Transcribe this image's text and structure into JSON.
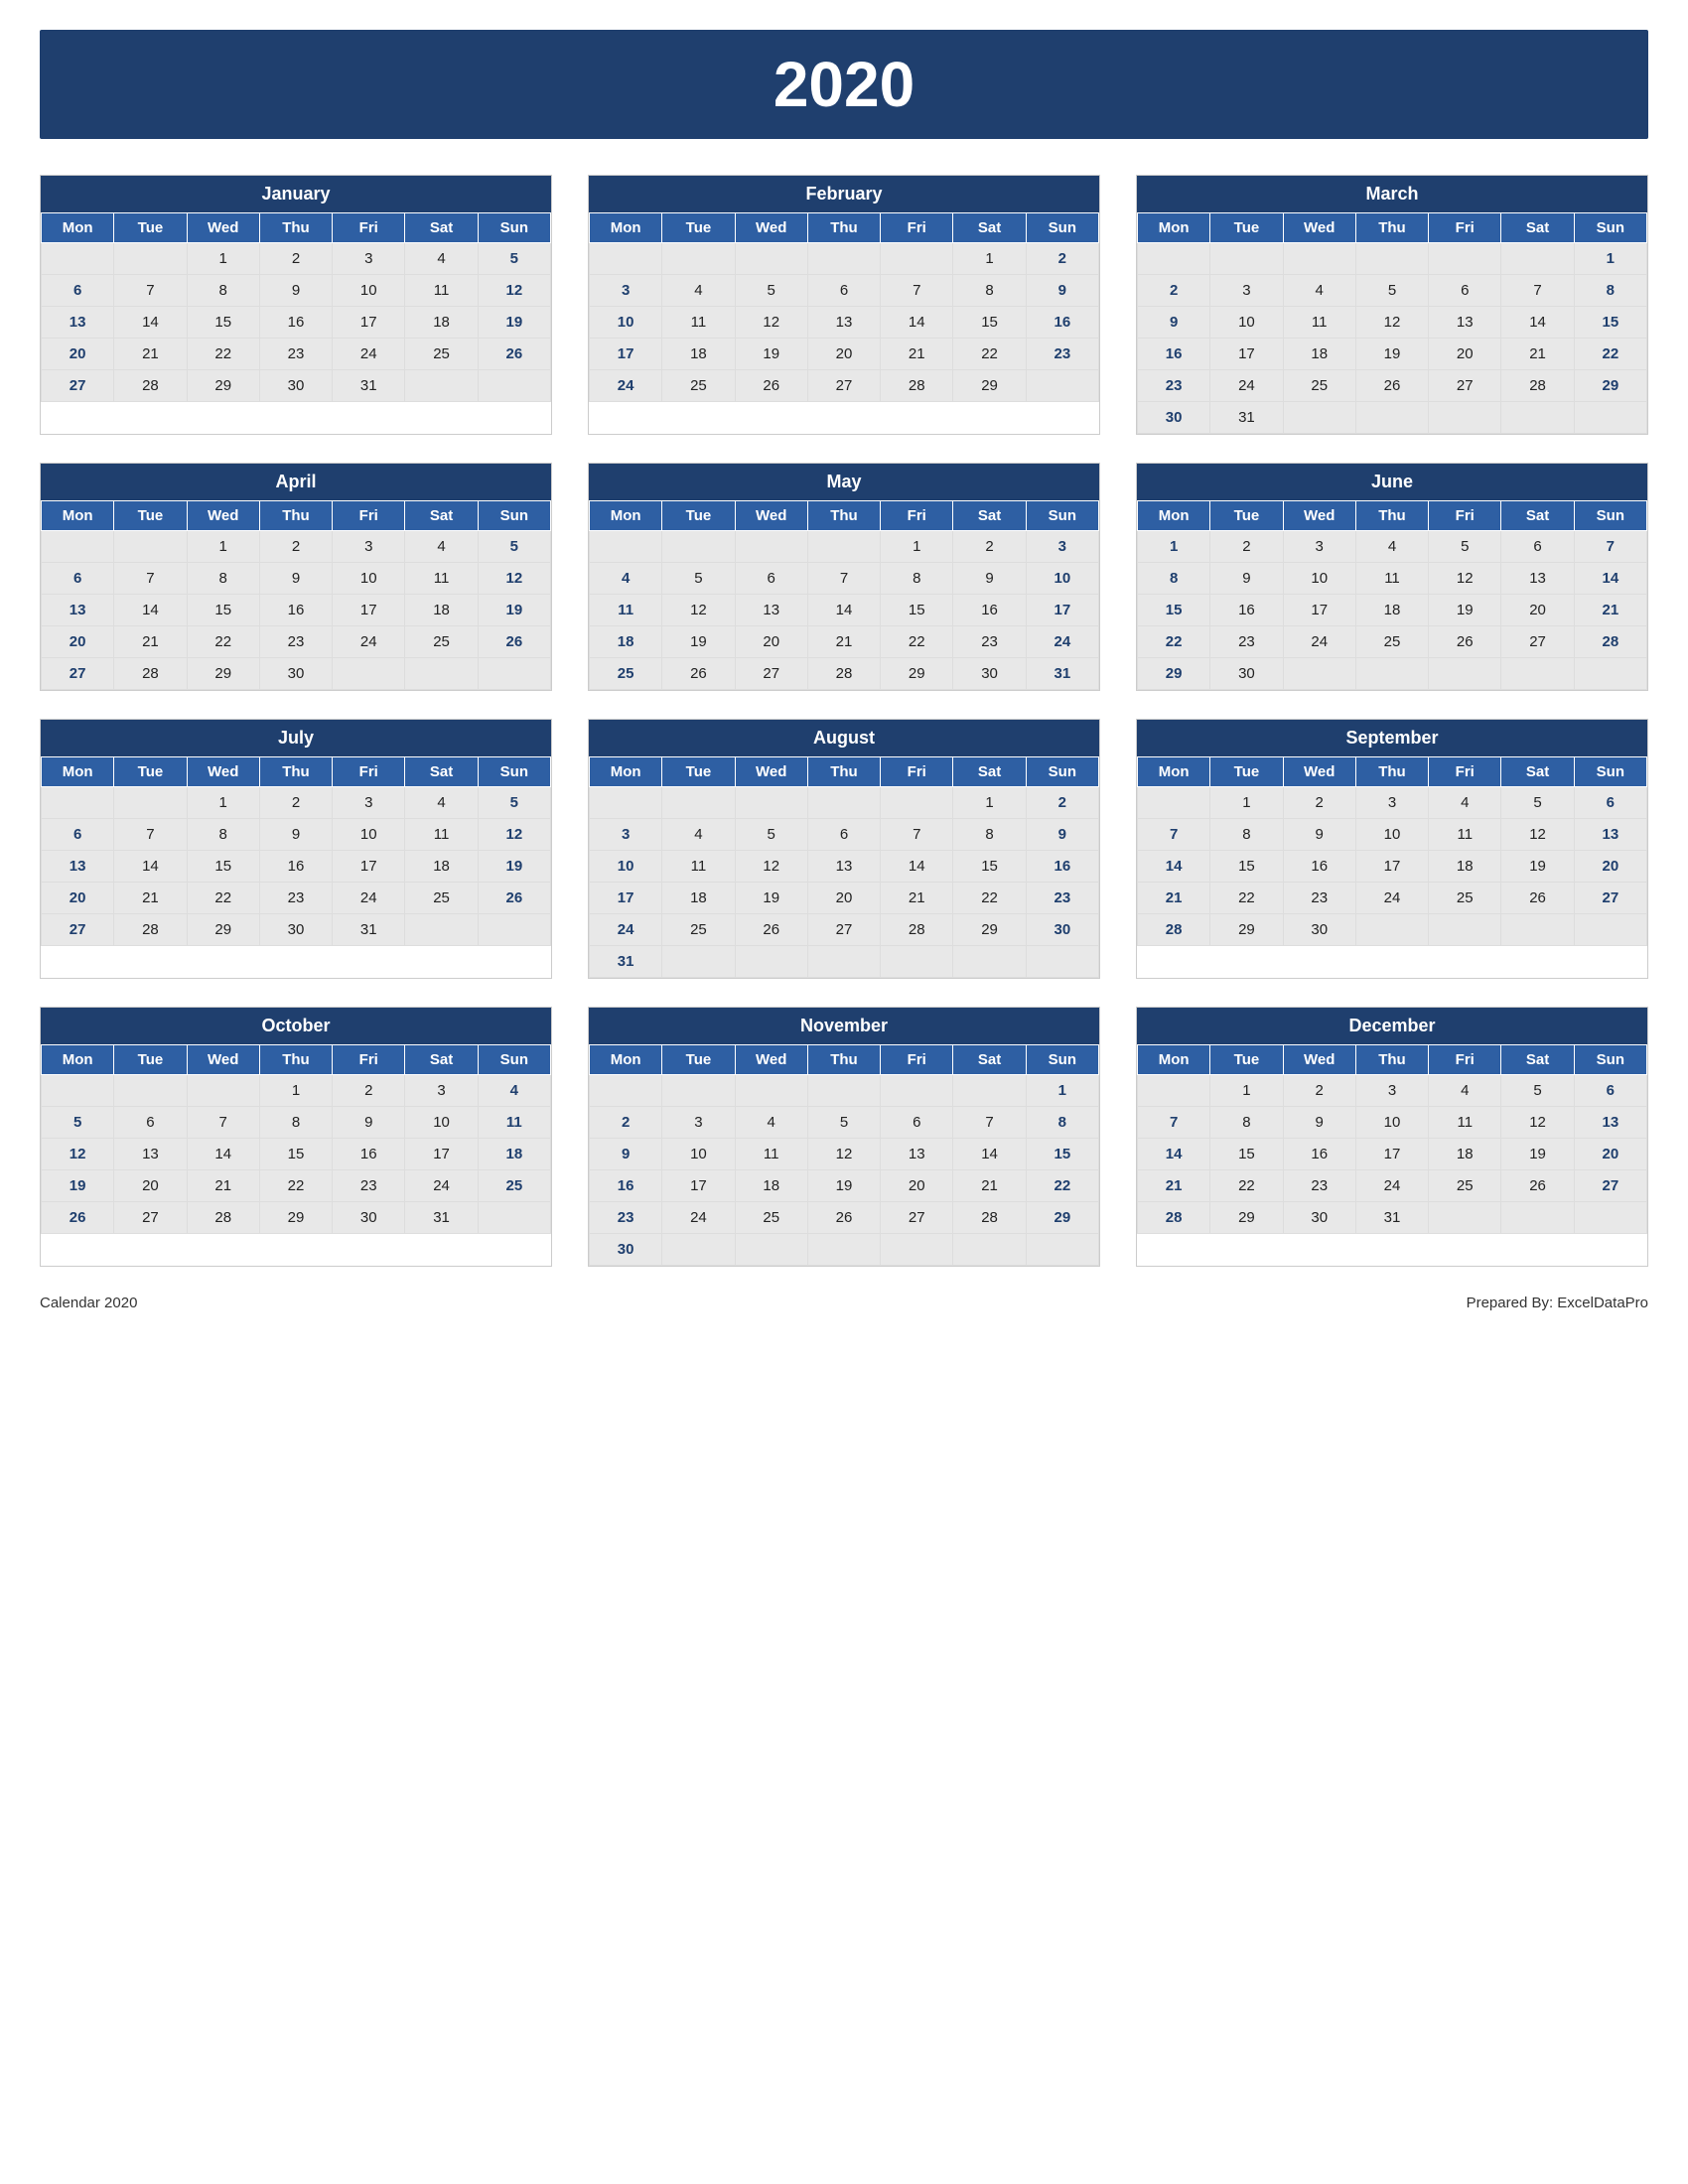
{
  "header": {
    "year": "2020"
  },
  "footer": {
    "left": "Calendar 2020",
    "right": "Prepared By: ExcelDataPro"
  },
  "months": [
    {
      "name": "January",
      "days_header": [
        "Mon",
        "Tue",
        "Wed",
        "Thu",
        "Fri",
        "Sat",
        "Sun"
      ],
      "weeks": [
        [
          "",
          "",
          "1",
          "2",
          "3",
          "4",
          "5"
        ],
        [
          "6",
          "7",
          "8",
          "9",
          "10",
          "11",
          "12"
        ],
        [
          "13",
          "14",
          "15",
          "16",
          "17",
          "18",
          "19"
        ],
        [
          "20",
          "21",
          "22",
          "23",
          "24",
          "25",
          "26"
        ],
        [
          "27",
          "28",
          "29",
          "30",
          "31",
          "",
          ""
        ]
      ]
    },
    {
      "name": "February",
      "days_header": [
        "Mon",
        "Tue",
        "Wed",
        "Thu",
        "Fri",
        "Sat",
        "Sun"
      ],
      "weeks": [
        [
          "",
          "",
          "",
          "",
          "",
          "1",
          "2"
        ],
        [
          "3",
          "4",
          "5",
          "6",
          "7",
          "8",
          "9"
        ],
        [
          "10",
          "11",
          "12",
          "13",
          "14",
          "15",
          "16"
        ],
        [
          "17",
          "18",
          "19",
          "20",
          "21",
          "22",
          "23"
        ],
        [
          "24",
          "25",
          "26",
          "27",
          "28",
          "29",
          ""
        ]
      ]
    },
    {
      "name": "March",
      "days_header": [
        "Mon",
        "Tue",
        "Wed",
        "Thu",
        "Fri",
        "Sat",
        "Sun"
      ],
      "weeks": [
        [
          "",
          "",
          "",
          "",
          "",
          "",
          "1"
        ],
        [
          "2",
          "3",
          "4",
          "5",
          "6",
          "7",
          "8"
        ],
        [
          "9",
          "10",
          "11",
          "12",
          "13",
          "14",
          "15"
        ],
        [
          "16",
          "17",
          "18",
          "19",
          "20",
          "21",
          "22"
        ],
        [
          "23",
          "24",
          "25",
          "26",
          "27",
          "28",
          "29"
        ],
        [
          "30",
          "31",
          "",
          "",
          "",
          "",
          ""
        ]
      ]
    },
    {
      "name": "April",
      "days_header": [
        "Mon",
        "Tue",
        "Wed",
        "Thu",
        "Fri",
        "Sat",
        "Sun"
      ],
      "weeks": [
        [
          "",
          "",
          "1",
          "2",
          "3",
          "4",
          "5"
        ],
        [
          "6",
          "7",
          "8",
          "9",
          "10",
          "11",
          "12"
        ],
        [
          "13",
          "14",
          "15",
          "16",
          "17",
          "18",
          "19"
        ],
        [
          "20",
          "21",
          "22",
          "23",
          "24",
          "25",
          "26"
        ],
        [
          "27",
          "28",
          "29",
          "30",
          "",
          "",
          ""
        ]
      ]
    },
    {
      "name": "May",
      "days_header": [
        "Mon",
        "Tue",
        "Wed",
        "Thu",
        "Fri",
        "Sat",
        "Sun"
      ],
      "weeks": [
        [
          "",
          "",
          "",
          "",
          "1",
          "2",
          "3"
        ],
        [
          "4",
          "5",
          "6",
          "7",
          "8",
          "9",
          "10"
        ],
        [
          "11",
          "12",
          "13",
          "14",
          "15",
          "16",
          "17"
        ],
        [
          "18",
          "19",
          "20",
          "21",
          "22",
          "23",
          "24"
        ],
        [
          "25",
          "26",
          "27",
          "28",
          "29",
          "30",
          "31"
        ]
      ]
    },
    {
      "name": "June",
      "days_header": [
        "Mon",
        "Tue",
        "Wed",
        "Thu",
        "Fri",
        "Sat",
        "Sun"
      ],
      "weeks": [
        [
          "1",
          "2",
          "3",
          "4",
          "5",
          "6",
          "7"
        ],
        [
          "8",
          "9",
          "10",
          "11",
          "12",
          "13",
          "14"
        ],
        [
          "15",
          "16",
          "17",
          "18",
          "19",
          "20",
          "21"
        ],
        [
          "22",
          "23",
          "24",
          "25",
          "26",
          "27",
          "28"
        ],
        [
          "29",
          "30",
          "",
          "",
          "",
          "",
          ""
        ]
      ]
    },
    {
      "name": "July",
      "days_header": [
        "Mon",
        "Tue",
        "Wed",
        "Thu",
        "Fri",
        "Sat",
        "Sun"
      ],
      "weeks": [
        [
          "",
          "",
          "1",
          "2",
          "3",
          "4",
          "5"
        ],
        [
          "6",
          "7",
          "8",
          "9",
          "10",
          "11",
          "12"
        ],
        [
          "13",
          "14",
          "15",
          "16",
          "17",
          "18",
          "19"
        ],
        [
          "20",
          "21",
          "22",
          "23",
          "24",
          "25",
          "26"
        ],
        [
          "27",
          "28",
          "29",
          "30",
          "31",
          "",
          ""
        ]
      ]
    },
    {
      "name": "August",
      "days_header": [
        "Mon",
        "Tue",
        "Wed",
        "Thu",
        "Fri",
        "Sat",
        "Sun"
      ],
      "weeks": [
        [
          "",
          "",
          "",
          "",
          "",
          "1",
          "2"
        ],
        [
          "3",
          "4",
          "5",
          "6",
          "7",
          "8",
          "9"
        ],
        [
          "10",
          "11",
          "12",
          "13",
          "14",
          "15",
          "16"
        ],
        [
          "17",
          "18",
          "19",
          "20",
          "21",
          "22",
          "23"
        ],
        [
          "24",
          "25",
          "26",
          "27",
          "28",
          "29",
          "30"
        ],
        [
          "31",
          "",
          "",
          "",
          "",
          "",
          ""
        ]
      ]
    },
    {
      "name": "September",
      "days_header": [
        "Mon",
        "Tue",
        "Wed",
        "Thu",
        "Fri",
        "Sat",
        "Sun"
      ],
      "weeks": [
        [
          "",
          "1",
          "2",
          "3",
          "4",
          "5",
          "6"
        ],
        [
          "7",
          "8",
          "9",
          "10",
          "11",
          "12",
          "13"
        ],
        [
          "14",
          "15",
          "16",
          "17",
          "18",
          "19",
          "20"
        ],
        [
          "21",
          "22",
          "23",
          "24",
          "25",
          "26",
          "27"
        ],
        [
          "28",
          "29",
          "30",
          "",
          "",
          "",
          ""
        ]
      ]
    },
    {
      "name": "October",
      "days_header": [
        "Mon",
        "Tue",
        "Wed",
        "Thu",
        "Fri",
        "Sat",
        "Sun"
      ],
      "weeks": [
        [
          "",
          "",
          "",
          "1",
          "2",
          "3",
          "4"
        ],
        [
          "5",
          "6",
          "7",
          "8",
          "9",
          "10",
          "11"
        ],
        [
          "12",
          "13",
          "14",
          "15",
          "16",
          "17",
          "18"
        ],
        [
          "19",
          "20",
          "21",
          "22",
          "23",
          "24",
          "25"
        ],
        [
          "26",
          "27",
          "28",
          "29",
          "30",
          "31",
          ""
        ]
      ]
    },
    {
      "name": "November",
      "days_header": [
        "Mon",
        "Tue",
        "Wed",
        "Thu",
        "Fri",
        "Sat",
        "Sun"
      ],
      "weeks": [
        [
          "",
          "",
          "",
          "",
          "",
          "",
          "1"
        ],
        [
          "2",
          "3",
          "4",
          "5",
          "6",
          "7",
          "8"
        ],
        [
          "9",
          "10",
          "11",
          "12",
          "13",
          "14",
          "15"
        ],
        [
          "16",
          "17",
          "18",
          "19",
          "20",
          "21",
          "22"
        ],
        [
          "23",
          "24",
          "25",
          "26",
          "27",
          "28",
          "29"
        ],
        [
          "30",
          "",
          "",
          "",
          "",
          "",
          ""
        ]
      ]
    },
    {
      "name": "December",
      "days_header": [
        "Mon",
        "Tue",
        "Wed",
        "Thu",
        "Fri",
        "Sat",
        "Sun"
      ],
      "weeks": [
        [
          "",
          "1",
          "2",
          "3",
          "4",
          "5",
          "6"
        ],
        [
          "7",
          "8",
          "9",
          "10",
          "11",
          "12",
          "13"
        ],
        [
          "14",
          "15",
          "16",
          "17",
          "18",
          "19",
          "20"
        ],
        [
          "21",
          "22",
          "23",
          "24",
          "25",
          "26",
          "27"
        ],
        [
          "28",
          "29",
          "30",
          "31",
          "",
          "",
          ""
        ]
      ]
    }
  ]
}
